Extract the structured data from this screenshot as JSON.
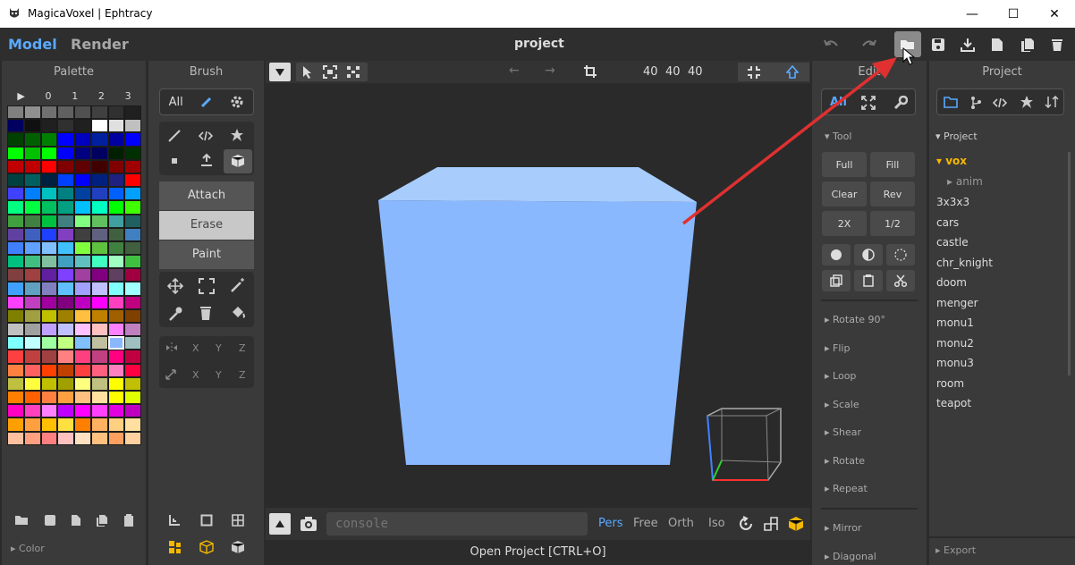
{
  "window": {
    "title": "MagicaVoxel | Ephtracy",
    "minimize": "—",
    "maximize": "☐",
    "close": "✕"
  },
  "topbar": {
    "mode_model": "Model",
    "mode_render": "Render",
    "project_title": "project"
  },
  "palette": {
    "title": "Palette",
    "tabs": [
      "▶",
      "0",
      "1",
      "2",
      "3"
    ],
    "footer": "Color",
    "colors": [
      "#808080",
      "#909090",
      "#707070",
      "#606060",
      "#505050",
      "#404040",
      "#303030",
      "#202020",
      "#000060",
      "#101010",
      "#202020",
      "#303030",
      "#202020",
      "#ffffff",
      "#e0e0e0",
      "#c0c0c0",
      "#004000",
      "#006000",
      "#008000",
      "#0000ff",
      "#0000c0",
      "#0020a0",
      "#0000a0",
      "#0000ff",
      "#00ff00",
      "#00c000",
      "#00ff00",
      "#0000ff",
      "#000080",
      "#000060",
      "#002000",
      "#003000",
      "#c00000",
      "#c00000",
      "#ff0000",
      "#800000",
      "#600000",
      "#400000",
      "#800000",
      "#a00000",
      "#004040",
      "#006060",
      "#002040",
      "#0040ff",
      "#0000ff",
      "#002080",
      "#202080",
      "#ff0000",
      "#4040ff",
      "#0080ff",
      "#00c0c0",
      "#008080",
      "#0040a0",
      "#2040c0",
      "#0060ff",
      "#00a0ff",
      "#00ff80",
      "#00ff40",
      "#00c060",
      "#00a080",
      "#00c0ff",
      "#00ffc0",
      "#00ff00",
      "#40ff00",
      "#40a040",
      "#408040",
      "#00c040",
      "#408080",
      "#80ff80",
      "#60c060",
      "#40a0a0",
      "#206060",
      "#6040a0",
      "#4060c0",
      "#2040ff",
      "#8040c0",
      "#404040",
      "#606080",
      "#406040",
      "#4080c0",
      "#4080ff",
      "#60a0ff",
      "#80c0ff",
      "#40c0ff",
      "#80ff40",
      "#60c040",
      "#408040",
      "#406040",
      "#00c080",
      "#40c080",
      "#80c0a0",
      "#40a0c0",
      "#60c0c0",
      "#40ffc0",
      "#a0ffc0",
      "#40c040",
      "#804040",
      "#a04040",
      "#6020a0",
      "#8040ff",
      "#a040a0",
      "#800080",
      "#604060",
      "#a00040",
      "#40a0ff",
      "#60a0c0",
      "#8080c0",
      "#60c0ff",
      "#a0a0ff",
      "#c0c0ff",
      "#80ffff",
      "#a0ffff",
      "#ff40ff",
      "#c040c0",
      "#a000a0",
      "#800080",
      "#c000c0",
      "#ff00ff",
      "#ff40c0",
      "#c00080",
      "#808000",
      "#a0a040",
      "#c0c000",
      "#a08000",
      "#ffc040",
      "#c08000",
      "#a06000",
      "#804000",
      "#c0c0c0",
      "#a0a0a0",
      "#c0a0ff",
      "#c0c0ff",
      "#ffc0ff",
      "#ffc0c0",
      "#ff80ff",
      "#c080c0",
      "#80ffff",
      "#c0ffff",
      "#a0ffa0",
      "#c0ff80",
      "#80c0ff",
      "#c0c0a0",
      "#8ab8ff",
      "#a0c0c0",
      "#ff4040",
      "#c04040",
      "#a04040",
      "#ff8080",
      "#ff4080",
      "#c04080",
      "#ff0080",
      "#c00040",
      "#ff8040",
      "#ff6060",
      "#ff4000",
      "#c04000",
      "#ff4040",
      "#ff6080",
      "#ff80c0",
      "#ff0040",
      "#c0c040",
      "#ffff40",
      "#c0c000",
      "#a0a000",
      "#ffff80",
      "#c0c080",
      "#ffff00",
      "#c0c000",
      "#ff8000",
      "#ff6000",
      "#ff8040",
      "#ffa040",
      "#ffc080",
      "#ffe0a0",
      "#ffff00",
      "#e0ff00",
      "#ff00c0",
      "#ff40c0",
      "#ff80ff",
      "#c000ff",
      "#ff00ff",
      "#ff40ff",
      "#e000e0",
      "#c000c0",
      "#ffa000",
      "#ffa040",
      "#ffc000",
      "#ffe040",
      "#ff8000",
      "#ffb060",
      "#ffd080",
      "#ffe0a0",
      "#ffc0a0",
      "#ffa080",
      "#ff8080",
      "#ffc0c0",
      "#ffe0c0",
      "#ffc080",
      "#ffa060",
      "#ffd0a0"
    ]
  },
  "brush": {
    "title": "Brush",
    "all": "All",
    "attach": "Attach",
    "erase": "Erase",
    "paint": "Paint",
    "x": "X",
    "y": "Y",
    "z": "Z"
  },
  "viewport": {
    "coords": [
      "40",
      "40",
      "40"
    ],
    "console_placeholder": "console",
    "status": "Open Project [CTRL+O]",
    "views": [
      "Pers",
      "Free",
      "Orth",
      "Iso"
    ]
  },
  "edit": {
    "title": "Edit",
    "all": "All",
    "tool_section": "Tool",
    "buttons": [
      "Full",
      "Fill",
      "Clear",
      "Rev",
      "2X",
      "1/2"
    ],
    "sections": [
      "Rotate 90°",
      "Flip",
      "Loop",
      "Scale",
      "Shear",
      "Rotate",
      "Repeat",
      "Mirror",
      "Diagonal"
    ]
  },
  "project": {
    "title": "Project",
    "section": "Project",
    "folder": "vox",
    "sub": "anim",
    "items": [
      "3x3x3",
      "cars",
      "castle",
      "chr_knight",
      "doom",
      "menger",
      "monu1",
      "monu2",
      "monu3",
      "room",
      "teapot"
    ],
    "export": "Export"
  },
  "colors": {
    "accent": "#5aa9ff",
    "cube_front": "#8ab8ff",
    "cube_top": "#a8cdfc",
    "arrow": "#e03030",
    "selected": "#ffcc00"
  }
}
